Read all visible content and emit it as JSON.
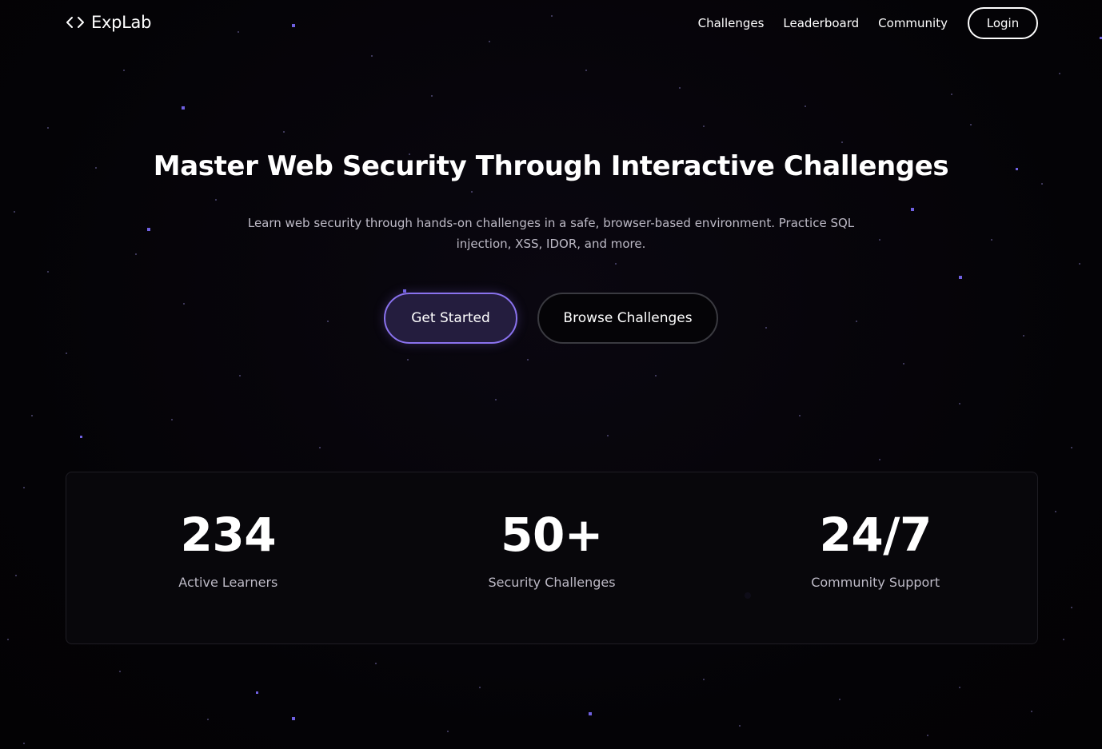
{
  "brand": {
    "name": "ExpLab",
    "icon": "code-brackets-icon"
  },
  "nav": {
    "links": [
      "Challenges",
      "Leaderboard",
      "Community"
    ],
    "login_label": "Login"
  },
  "hero": {
    "title": "Master Web Security Through Interactive Challenges",
    "subtitle": "Learn web security through hands-on challenges in a safe, browser-based environment. Practice SQL injection, XSS, IDOR, and more.",
    "primary_cta": "Get Started",
    "secondary_cta": "Browse Challenges"
  },
  "stats": [
    {
      "value": "234",
      "label": "Active Learners"
    },
    {
      "value": "50+",
      "label": "Security Challenges"
    },
    {
      "value": "24/7",
      "label": "Community Support"
    }
  ],
  "colors": {
    "background": "#050307",
    "accent": "#8a72ee",
    "primary_button_fill": "#241d3e",
    "muted_text": "#bdbac6",
    "star": "#6f60e0"
  }
}
